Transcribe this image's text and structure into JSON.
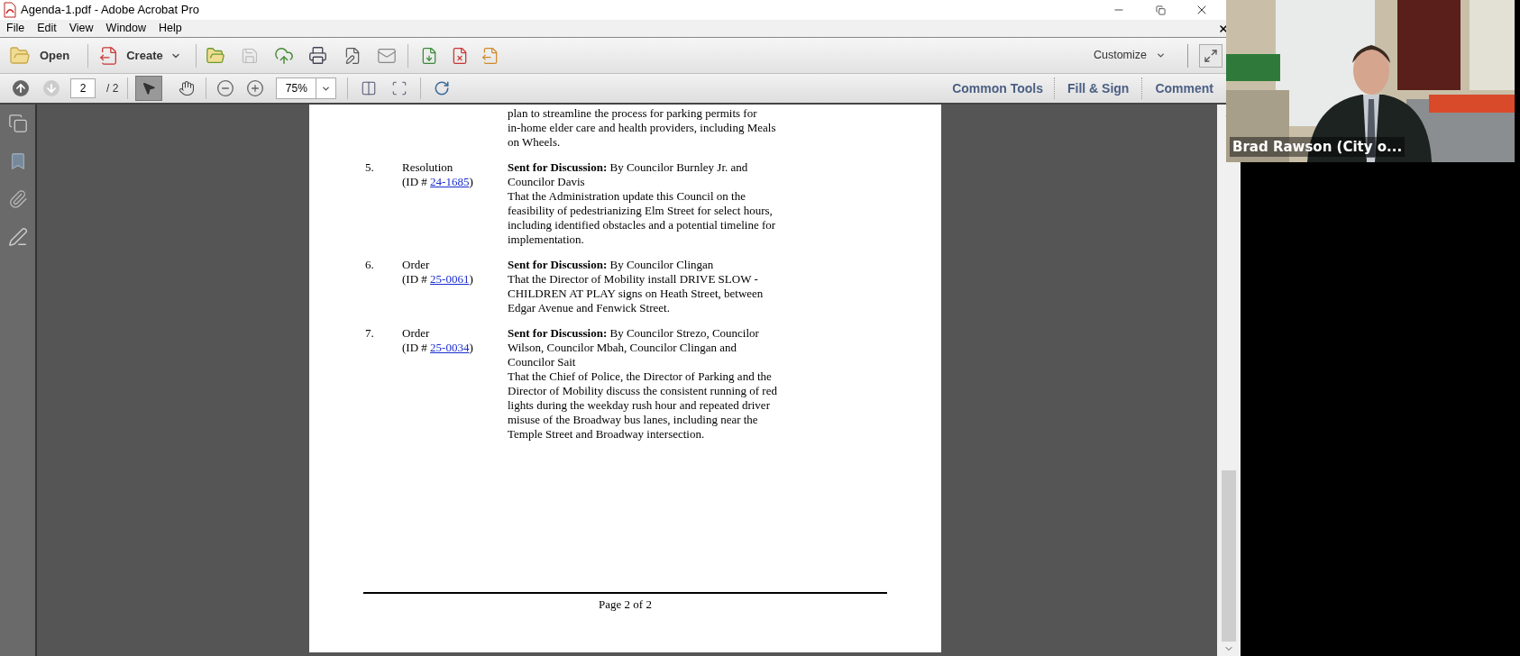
{
  "window": {
    "title": "Agenda-1.pdf - Adobe Acrobat Pro"
  },
  "menu": [
    "File",
    "Edit",
    "View",
    "Window",
    "Help"
  ],
  "toolbar": {
    "open": "Open",
    "create": "Create",
    "customize": "Customize"
  },
  "nav": {
    "page": "2",
    "page_count": "/ 2",
    "zoom": "75%"
  },
  "panes": [
    "Common Tools",
    "Fill & Sign",
    "Comment"
  ],
  "document": {
    "continued": [
      "plan to streamline the process for parking permits for",
      "in-home elder care and health providers, including Meals",
      "on Wheels."
    ],
    "items": [
      {
        "number": "5.",
        "type": "Resolution",
        "id_prefix": "(ID # ",
        "id": "24-1685",
        "id_suffix": ")",
        "lines": [
          "**Sent for Discussion:** By Councilor Burnley Jr. and",
          "Councilor Davis",
          "That the Administration update this Council on the",
          "feasibility of pedestrianizing Elm Street for select hours,",
          "including identified obstacles and a potential timeline for",
          "implementation."
        ]
      },
      {
        "number": "6.",
        "type": "Order",
        "id_prefix": "(ID # ",
        "id": "25-0061",
        "id_suffix": ")",
        "lines": [
          "**Sent for Discussion:** By Councilor Clingan",
          "That the Director of Mobility install DRIVE SLOW -",
          "CHILDREN AT PLAY signs on Heath Street, between",
          "Edgar Avenue and Fenwick Street."
        ]
      },
      {
        "number": "7.",
        "type": "Order",
        "id_prefix": "(ID # ",
        "id": "25-0034",
        "id_suffix": ")",
        "lines": [
          "**Sent for Discussion:** By Councilor Strezo, Councilor",
          "Wilson, Councilor Mbah, Councilor Clingan and",
          "Councilor Sait",
          "That the Chief of Police, the Director of Parking and the",
          "Director of Mobility discuss the consistent running of red",
          "lights during the weekday rush hour and repeated driver",
          "misuse of the Broadway bus lanes, including near the",
          "Temple Street and Broadway intersection."
        ]
      }
    ],
    "footer": "Page 2 of 2"
  },
  "video": {
    "name": "Brad Rawson (City o..."
  }
}
